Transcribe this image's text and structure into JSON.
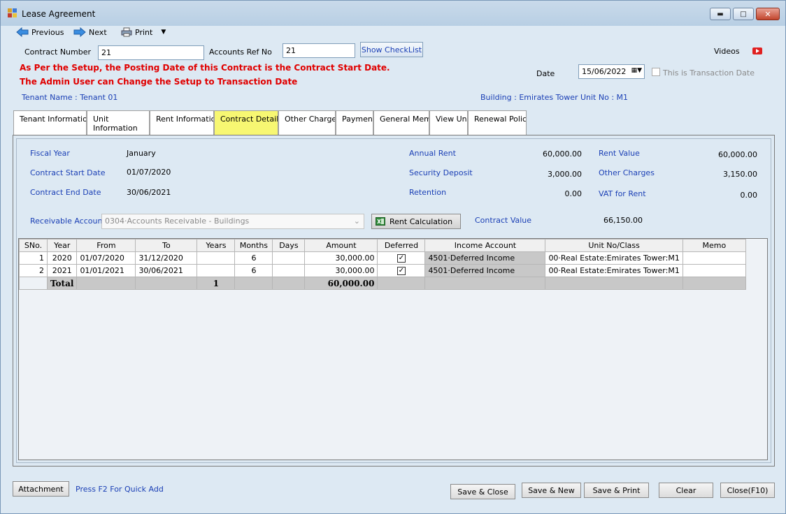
{
  "window": {
    "title": "Lease Agreement"
  },
  "toolbar": {
    "previous": "Previous",
    "next": "Next",
    "print": "Print"
  },
  "header": {
    "contract_number_label": "Contract Number",
    "contract_number": "21",
    "accounts_ref_label": "Accounts Ref No",
    "accounts_ref": "21",
    "show_checklist": "Show CheckList",
    "videos": "Videos",
    "notice_line1": "As Per the Setup, the Posting Date of this Contract is the Contract Start Date.",
    "notice_line2": "The Admin User can Change the Setup to Transaction Date",
    "date_label": "Date",
    "date": "15/06/2022",
    "transaction_date_label": "This is Transaction Date",
    "tenant_name": "Tenant Name : Tenant 01",
    "building": "Building : Emirates Tower  Unit No : M1"
  },
  "tabs": [
    {
      "label": "Tenant Information"
    },
    {
      "label": "Unit Information"
    },
    {
      "label": "Rent Information"
    },
    {
      "label": "Contract Details"
    },
    {
      "label": "Other Charges"
    },
    {
      "label": "Payment"
    },
    {
      "label": "General Memo"
    },
    {
      "label": "View Unit"
    },
    {
      "label": "Renewal Policy"
    }
  ],
  "details": {
    "fiscal_year_label": "Fiscal Year",
    "fiscal_year": "January",
    "start_label": "Contract Start Date",
    "start": "01/07/2020",
    "end_label": "Contract End Date",
    "end": "30/06/2021",
    "annual_rent_label": "Annual Rent",
    "annual_rent": "60,000.00",
    "security_label": "Security Deposit",
    "security": "3,000.00",
    "retention_label": "Retention",
    "retention": "0.00",
    "rent_value_label": "Rent Value",
    "rent_value": "60,000.00",
    "other_charges_label": "Other Charges",
    "other_charges": "3,150.00",
    "vat_label": "VAT for Rent",
    "vat": "0.00",
    "receivable_label": "Receivable Account",
    "receivable": "0304·Accounts Receivable - Buildings",
    "rent_calc": "Rent Calculation",
    "contract_value_label": "Contract Value",
    "contract_value": "66,150.00"
  },
  "table": {
    "headers": [
      "SNo.",
      "Year",
      "From",
      "To",
      "Years",
      "Months",
      "Days",
      "Amount",
      "Deferred",
      "Income Account",
      "Unit No/Class",
      "Memo"
    ],
    "rows": [
      {
        "sno": "1",
        "year": "2020",
        "from": "01/07/2020",
        "to": "31/12/2020",
        "years": "",
        "months": "6",
        "days": "",
        "amount": "30,000.00",
        "income": "4501·Deferred Income",
        "unit": "00·Real Estate:Emirates Tower:M1",
        "memo": ""
      },
      {
        "sno": "2",
        "year": "2021",
        "from": "01/01/2021",
        "to": "30/06/2021",
        "years": "",
        "months": "6",
        "days": "",
        "amount": "30,000.00",
        "income": "4501·Deferred Income",
        "unit": "00·Real Estate:Emirates Tower:M1",
        "memo": ""
      }
    ],
    "total_label": "Total",
    "total_years": "1",
    "total_amount": "60,000.00"
  },
  "footer": {
    "attachment": "Attachment",
    "quick_add": "Press F2 For Quick Add",
    "save_close": "Save & Close",
    "save_new": "Save & New",
    "save_print": "Save & Print",
    "clear": "Clear",
    "close": "Close(F10)"
  }
}
